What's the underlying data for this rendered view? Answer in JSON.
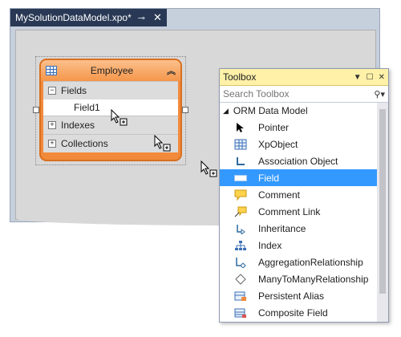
{
  "document": {
    "tab_title": "MySolutionDataModel.xpo*",
    "pin_icon": "pin-icon",
    "close_icon": "close-icon"
  },
  "class_shape": {
    "title": "Employee",
    "sections": [
      {
        "label": "Fields",
        "toggle": "−"
      },
      {
        "label": "Indexes",
        "toggle": "+"
      },
      {
        "label": "Collections",
        "toggle": "+"
      }
    ],
    "field": "Field1"
  },
  "toolbox": {
    "title": "Toolbox",
    "search_placeholder": "Search Toolbox",
    "group": "ORM Data Model",
    "items": [
      {
        "label": "Pointer",
        "icon": "pointer-icon"
      },
      {
        "label": "XpObject",
        "icon": "table-icon"
      },
      {
        "label": "Association Object",
        "icon": "association-icon"
      },
      {
        "label": "Field",
        "icon": "field-icon"
      },
      {
        "label": "Comment",
        "icon": "comment-icon"
      },
      {
        "label": "Comment Link",
        "icon": "comment-link-icon"
      },
      {
        "label": "Inheritance",
        "icon": "inheritance-icon"
      },
      {
        "label": "Index",
        "icon": "index-icon"
      },
      {
        "label": "AggregationRelationship",
        "icon": "aggregation-icon"
      },
      {
        "label": "ManyToManyRelationship",
        "icon": "many-to-many-icon"
      },
      {
        "label": "Persistent Alias",
        "icon": "alias-icon"
      },
      {
        "label": "Composite Field",
        "icon": "composite-field-icon"
      }
    ],
    "selected": "Field"
  }
}
